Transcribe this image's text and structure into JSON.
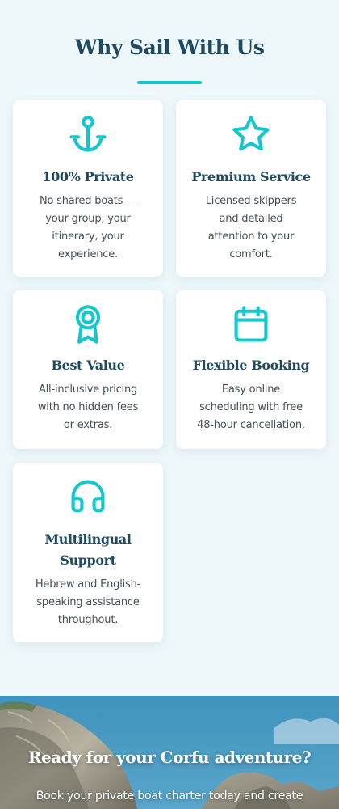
{
  "features": {
    "title": "Why Sail With Us",
    "accent_color": "#14c7cc",
    "cards": [
      {
        "icon": "anchor-icon",
        "title": "100% Private",
        "desc_lines": [
          "No shared boats —",
          "your group, your",
          "itinerary, your",
          "experience."
        ]
      },
      {
        "icon": "star-icon",
        "title": "Premium Service",
        "desc_lines": [
          "Licensed skippers",
          "and detailed",
          "attention to your",
          "comfort."
        ]
      },
      {
        "icon": "award-ribbon-icon",
        "title": "Best Value",
        "desc_lines": [
          "All-inclusive pricing",
          "with no hidden fees",
          "or extras."
        ]
      },
      {
        "icon": "calendar-icon",
        "title": "Flexible Booking",
        "desc_lines": [
          "Easy online",
          "scheduling with free",
          "48-hour cancellation."
        ]
      },
      {
        "icon": "headphones-icon",
        "title_lines": [
          "Multilingual",
          "Support"
        ],
        "desc_lines": [
          "Hebrew and English-",
          "speaking assistance",
          "throughout."
        ]
      }
    ]
  },
  "cta": {
    "title": "Ready for your Corfu adventure?",
    "text": "Book your private boat charter today and create"
  }
}
